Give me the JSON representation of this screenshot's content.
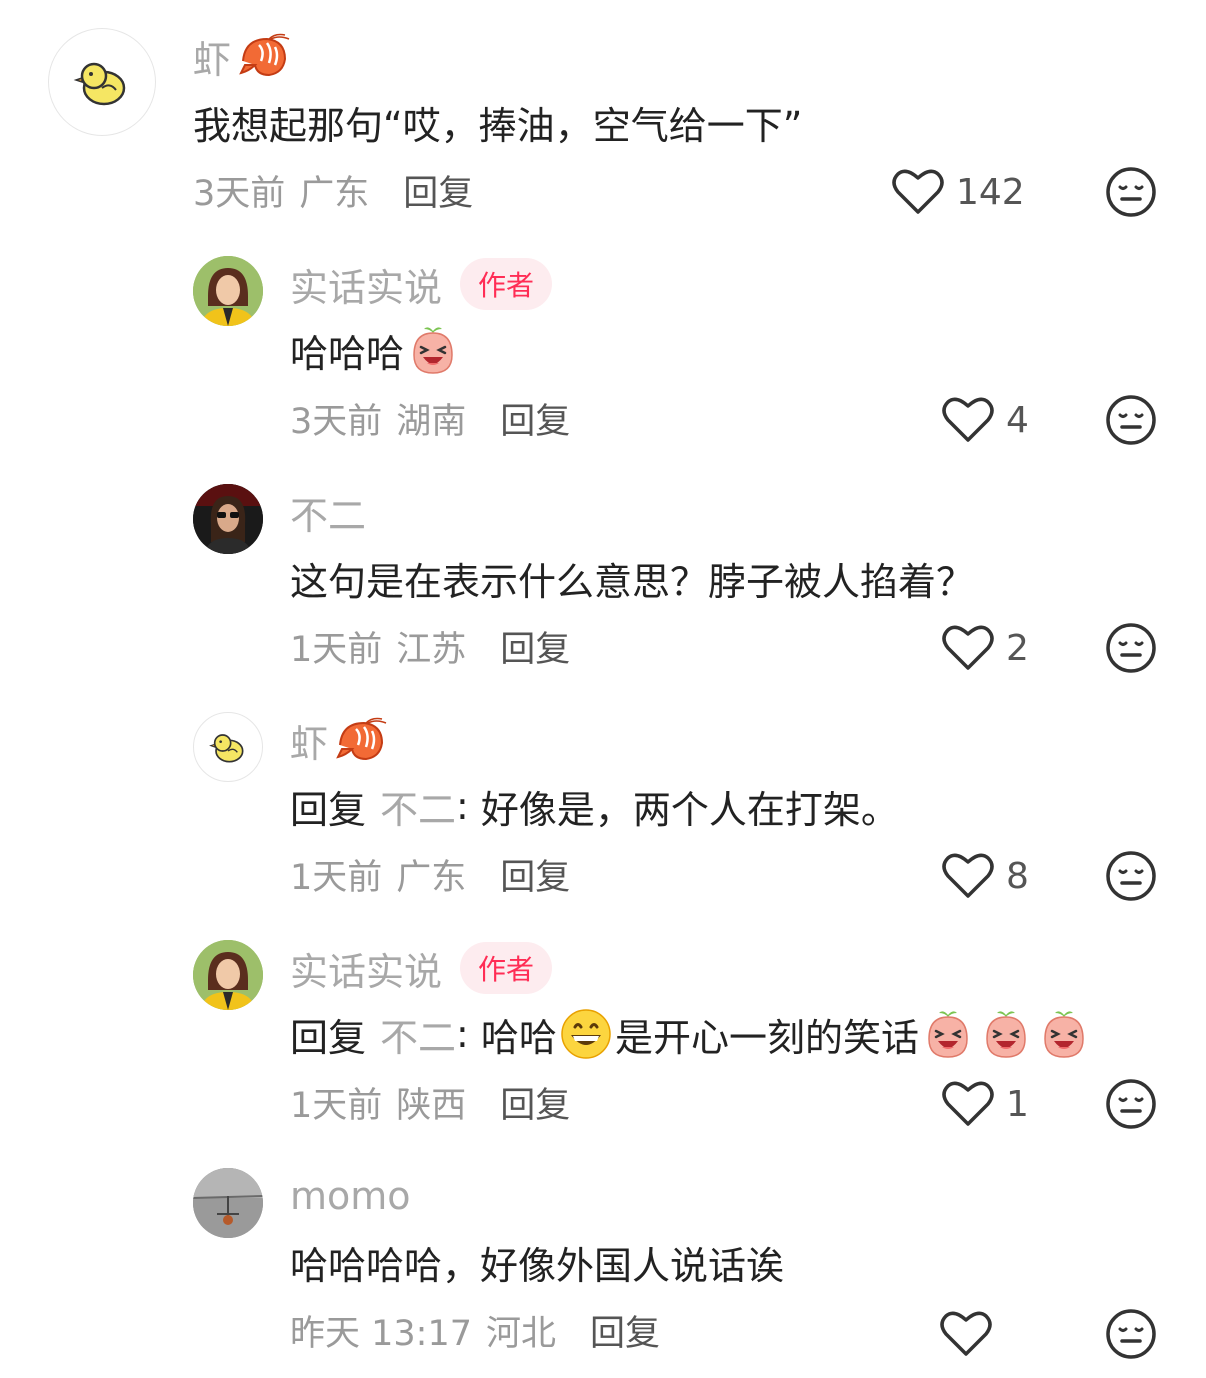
{
  "comments": [
    {
      "name": "虾",
      "author_badge": "",
      "content": "我想起那句“哎，捧油，空气给一下”",
      "time": "3天前",
      "location": "广东",
      "reply_label": "回复",
      "likes": "142"
    },
    {
      "name": "实话实说",
      "author_badge": "作者",
      "content": "哈哈哈",
      "time": "3天前",
      "location": "湖南",
      "reply_label": "回复",
      "likes": "4"
    },
    {
      "name": "不二",
      "author_badge": "",
      "content": "这句是在表示什么意思？脖子被人掐着？",
      "time": "1天前",
      "location": "江苏",
      "reply_label": "回复",
      "likes": "2"
    },
    {
      "name": "虾",
      "author_badge": "",
      "reply_prefix": "回复",
      "reply_target": "不二",
      "content": "好像是，两个人在打架。",
      "time": "1天前",
      "location": "广东",
      "reply_label": "回复",
      "likes": "8"
    },
    {
      "name": "实话实说",
      "author_badge": "作者",
      "reply_prefix": "回复",
      "reply_target": "不二",
      "content_a": "哈哈",
      "content_b": "是开心一刻的笑话",
      "time": "1天前",
      "location": "陕西",
      "reply_label": "回复",
      "likes": "1"
    },
    {
      "name": "momo",
      "author_badge": "",
      "content": "哈哈哈哈，好像外国人说话诶",
      "time": "昨天 13:17",
      "location": "河北",
      "reply_label": "回复",
      "likes": ""
    }
  ],
  "icons": {
    "like": "heart-outline-icon",
    "dislike": "neutral-face-icon",
    "name_emoji": "shrimp-emoji",
    "laugh_emoji": "laughing-peach-emoji",
    "grin_emoji": "grinning-face-emoji"
  },
  "colors": {
    "name_gray": "#a8a8a8",
    "author_badge_bg": "#fdecef",
    "author_badge_text": "#ff2d55"
  }
}
